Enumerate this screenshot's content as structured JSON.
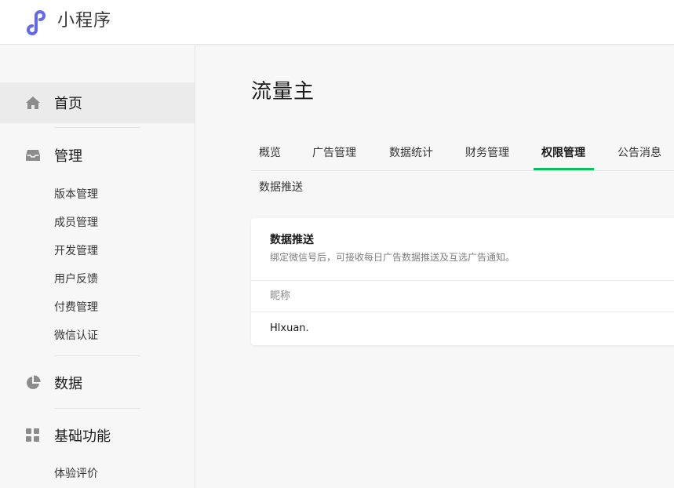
{
  "app": {
    "title": "小程序",
    "logo_icon": "miniprogram-logo-icon",
    "accent_color": "#07c160",
    "logo_color": "#6467f0"
  },
  "sidebar": {
    "groups": [
      {
        "label": "首页",
        "icon": "home-icon",
        "active": true,
        "items": []
      },
      {
        "label": "管理",
        "icon": "inbox-icon",
        "active": false,
        "items": [
          "版本管理",
          "成员管理",
          "开发管理",
          "用户反馈",
          "付费管理",
          "微信认证"
        ]
      },
      {
        "label": "数据",
        "icon": "pie-chart-icon",
        "active": false,
        "items": []
      },
      {
        "label": "基础功能",
        "icon": "grid-icon",
        "active": false,
        "items": [
          "体验评价"
        ]
      }
    ]
  },
  "main": {
    "title": "流量主",
    "tabs": [
      {
        "label": "概览",
        "active": false
      },
      {
        "label": "广告管理",
        "active": false
      },
      {
        "label": "数据统计",
        "active": false
      },
      {
        "label": "财务管理",
        "active": false
      },
      {
        "label": "权限管理",
        "active": true
      },
      {
        "label": "公告消息",
        "active": false
      }
    ],
    "subtab": "数据推送",
    "card": {
      "title": "数据推送",
      "description": "绑定微信号后，可接收每日广告数据推送及互选广告通知。",
      "table": {
        "columns": [
          "昵称"
        ],
        "rows": [
          [
            "Hlxuan."
          ]
        ]
      }
    }
  }
}
